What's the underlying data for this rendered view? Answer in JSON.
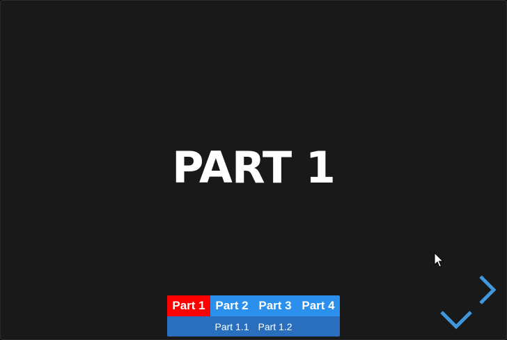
{
  "slide": {
    "title": "PART 1"
  },
  "menu": {
    "tabs": [
      {
        "label": "Part 1",
        "active": true
      },
      {
        "label": "Part 2",
        "active": false
      },
      {
        "label": "Part 3",
        "active": false
      },
      {
        "label": "Part 4",
        "active": false
      }
    ],
    "subtabs": [
      {
        "label": "Part 1.1"
      },
      {
        "label": "Part 1.2"
      }
    ]
  },
  "controls": {
    "next_icon": "chevron-right-icon",
    "down_icon": "chevron-down-icon",
    "color": "#3f97dc"
  },
  "colors": {
    "background": "#191919",
    "active_tab": "#ff0000",
    "tab_bar": "#2b90ec",
    "sub_bar": "#2a6fbe"
  }
}
